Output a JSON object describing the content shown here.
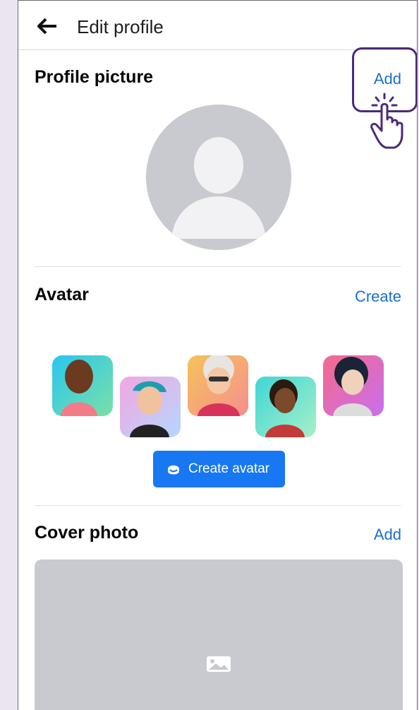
{
  "header": {
    "title": "Edit profile"
  },
  "profile_picture": {
    "title": "Profile picture",
    "action": "Add"
  },
  "avatar": {
    "title": "Avatar",
    "action": "Create",
    "button_label": "Create avatar"
  },
  "cover_photo": {
    "title": "Cover photo",
    "action": "Add"
  },
  "colors": {
    "link": "#1a6fd1",
    "button": "#1877f2",
    "highlight": "#4b2a7d",
    "placeholder": "#c9cad0"
  }
}
